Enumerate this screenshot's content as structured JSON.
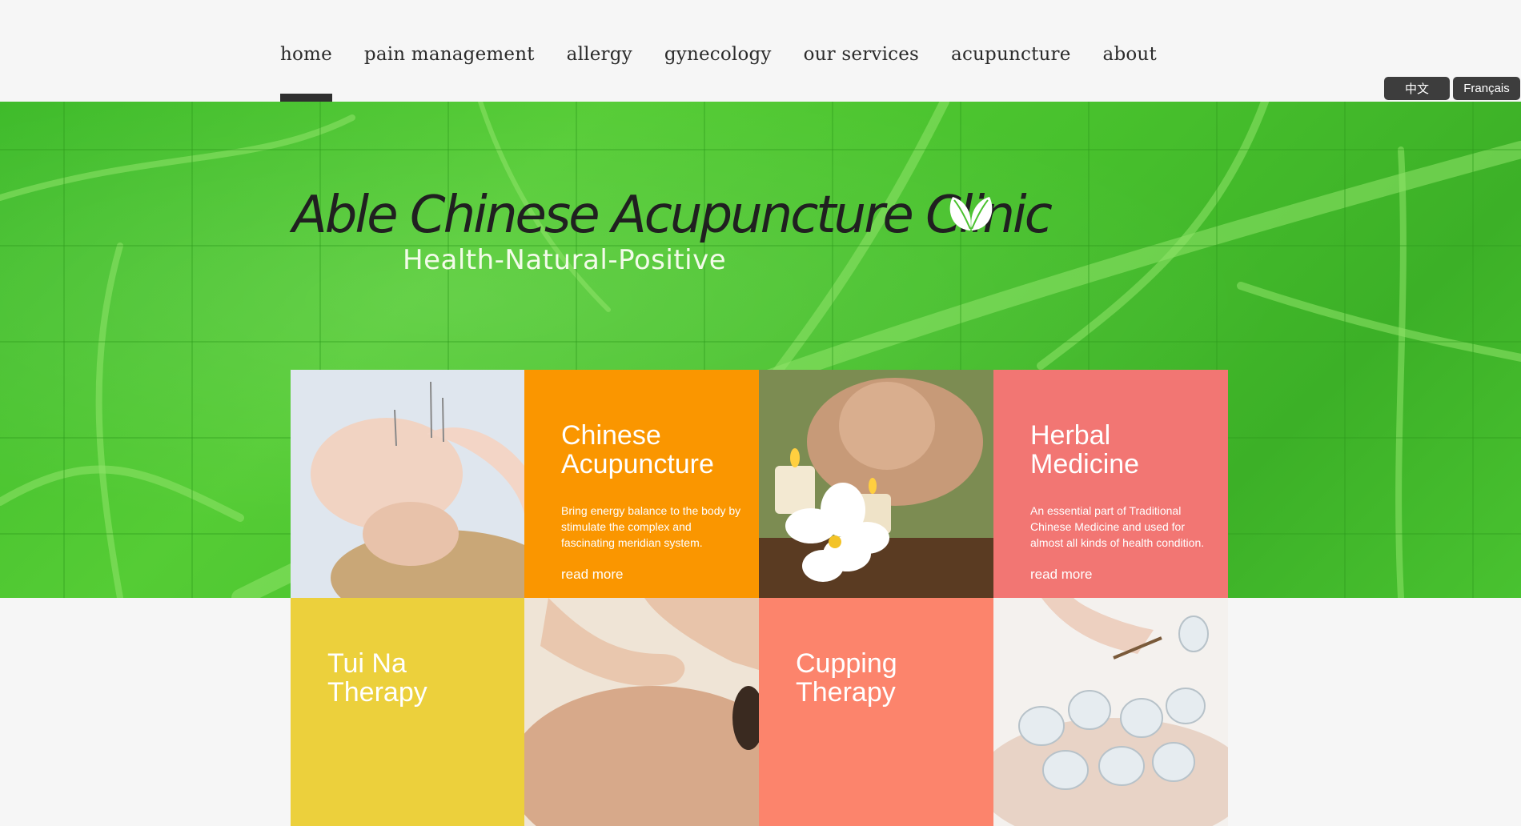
{
  "nav": {
    "items": [
      {
        "label": "home",
        "active": true
      },
      {
        "label": "pain management"
      },
      {
        "label": "allergy"
      },
      {
        "label": "gynecology"
      },
      {
        "label": "our services"
      },
      {
        "label": "acupuncture"
      },
      {
        "label": "about"
      }
    ]
  },
  "languages": {
    "chinese": "中文",
    "french": "Français"
  },
  "hero": {
    "title": "Able Chinese Acupuncture Clinic",
    "tagline": "Health-Natural-Positive",
    "logo_icon": "leaf-icon",
    "background_color": "#4bc22f"
  },
  "tiles": {
    "acupuncture": {
      "title_line1": "Chinese",
      "title_line2": "Acupuncture",
      "description": "Bring energy balance to the body by stimulate the complex and fascinating meridian system.",
      "link": "read more",
      "color": "#fa9600"
    },
    "herbal": {
      "title_line1": "Herbal",
      "title_line2": "Medicine",
      "description": "An essential part of Traditional Chinese Medicine and used for almost all kinds of health condition.",
      "link": "read more",
      "color": "#f27673"
    },
    "tuina": {
      "title_line1": "Tui Na",
      "title_line2": "Therapy",
      "color": "#ecd03c"
    },
    "cupping": {
      "title_line1": "Cupping",
      "title_line2": "Therapy",
      "color": "#fc846c"
    }
  }
}
